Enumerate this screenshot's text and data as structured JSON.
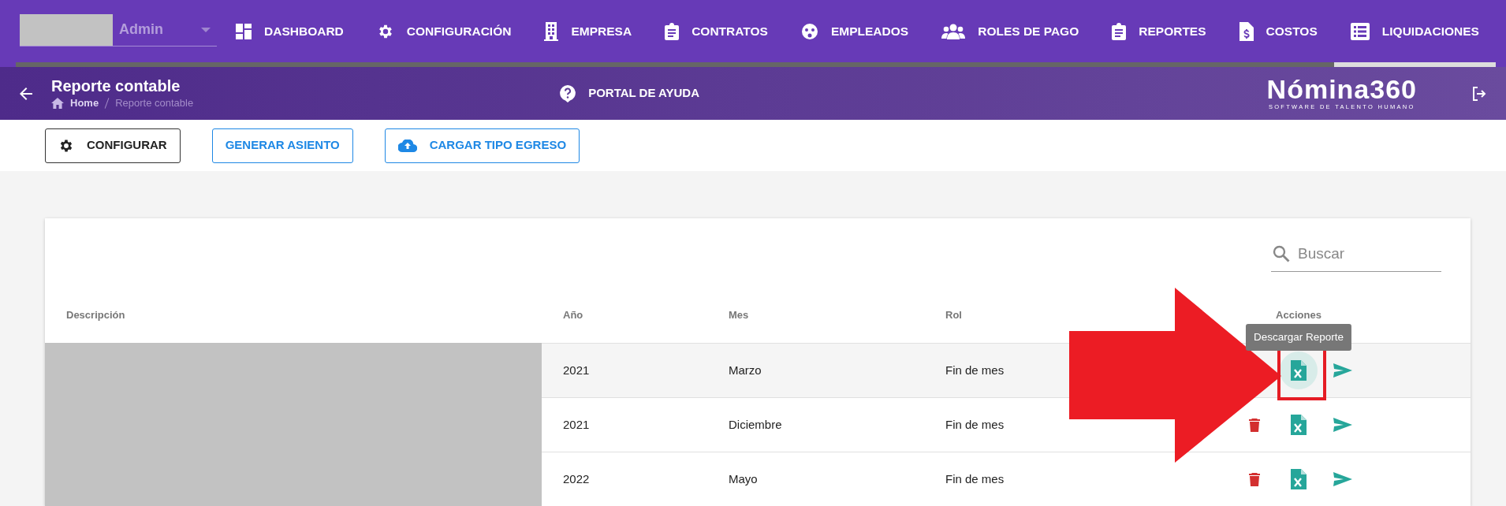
{
  "user": {
    "role": "Admin"
  },
  "nav": [
    {
      "label": "DASHBOARD",
      "selected": false
    },
    {
      "label": "CONFIGURACIÓN",
      "selected": false
    },
    {
      "label": "EMPRESA",
      "selected": false
    },
    {
      "label": "CONTRATOS",
      "selected": false
    },
    {
      "label": "EMPLEADOS",
      "selected": false
    },
    {
      "label": "ROLES DE PAGO",
      "selected": false
    },
    {
      "label": "REPORTES",
      "selected": false
    },
    {
      "label": "COSTOS",
      "selected": false
    },
    {
      "label": "LIQUIDACIONES",
      "selected": true
    }
  ],
  "header": {
    "title": "Reporte contable",
    "breadcrumb": [
      "Home",
      "Reporte contable"
    ],
    "help": "PORTAL DE AYUDA",
    "logo": "Nómina360",
    "logo_tagline": "SOFTWARE DE TALENTO HUMANO"
  },
  "toolbar": [
    {
      "label": "CONFIGURAR",
      "kind": "dark"
    },
    {
      "label": "GENERAR ASIENTO",
      "kind": "plain"
    },
    {
      "label": "CARGAR TIPO EGRESO",
      "kind": "upload"
    }
  ],
  "search": {
    "placeholder": "Buscar"
  },
  "table": {
    "columns": [
      "Descripción",
      "Año",
      "Mes",
      "Rol",
      "Acciones"
    ],
    "rows": [
      {
        "year": "2021",
        "month": "Marzo",
        "rol": "Fin de mes",
        "highlighted": true
      },
      {
        "year": "2021",
        "month": "Diciembre",
        "rol": "Fin de mes",
        "highlighted": false
      },
      {
        "year": "2022",
        "month": "Mayo",
        "rol": "Fin de mes",
        "highlighted": false
      }
    ]
  },
  "tooltip": "Descargar Reporte"
}
